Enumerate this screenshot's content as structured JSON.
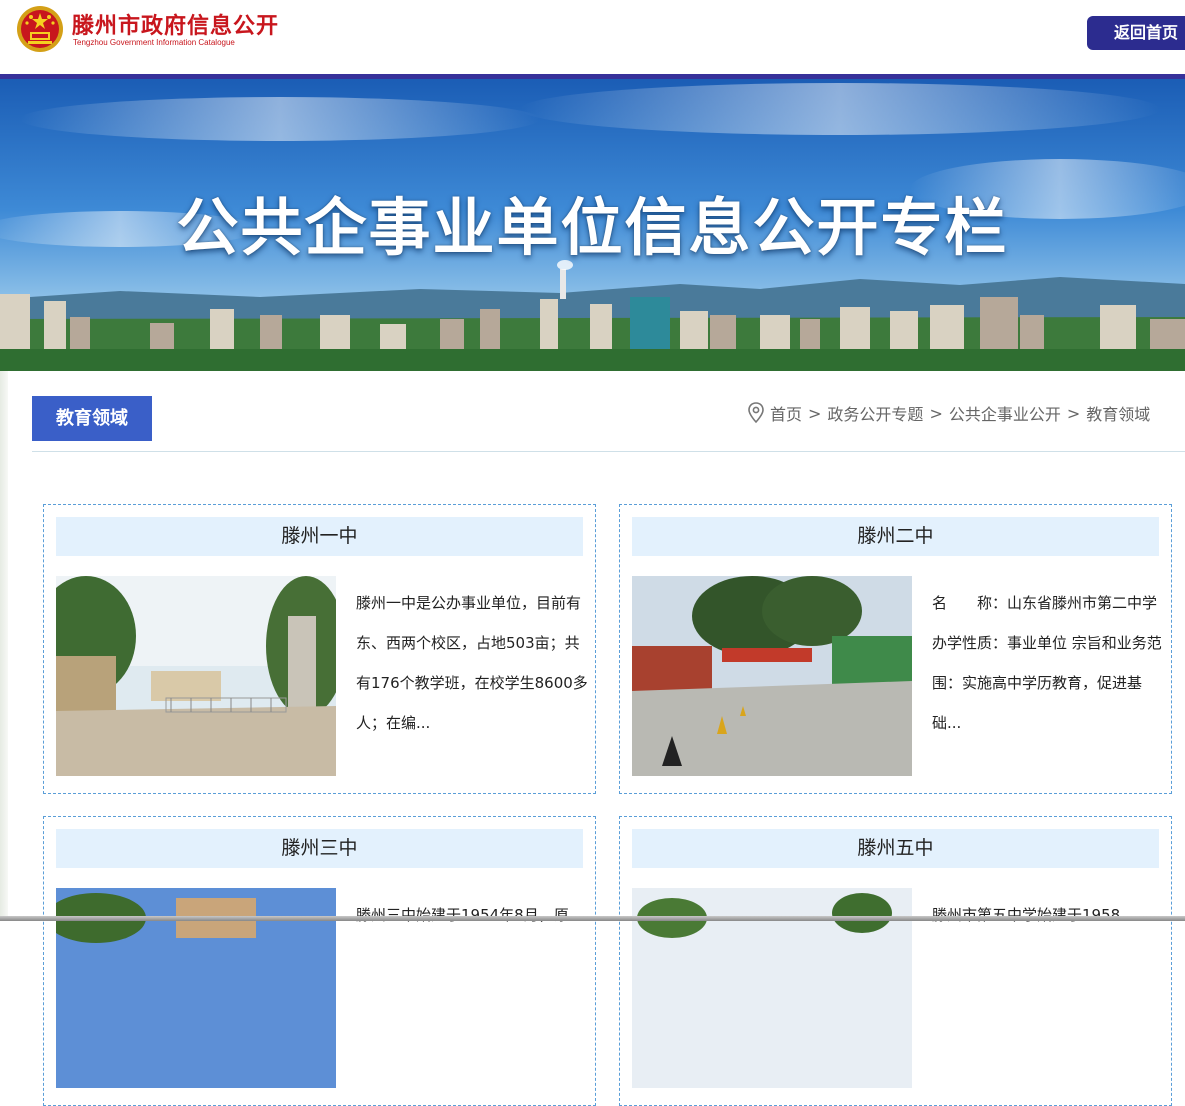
{
  "header": {
    "site_title": "滕州市政府信息公开",
    "site_subtitle": "Tengzhou Government Information Catalogue",
    "home_button": "返回首页",
    "accent_color": "#37319a",
    "title_color": "#c8161d"
  },
  "banner": {
    "title": "公共企事业单位信息公开专栏"
  },
  "section": {
    "tab_label": "教育领域",
    "tab_color": "#3a5fc8"
  },
  "breadcrumb": {
    "icon": "location-pin-icon",
    "items": [
      "首页",
      "政务公开专题",
      "公共企事业公开",
      "教育领域"
    ],
    "separator": ">"
  },
  "cards": [
    {
      "title": "滕州一中",
      "text": "滕州一中是公办事业单位，目前有东、西两个校区，占地503亩；共有176个教学班，在校学生8600多人；在编..."
    },
    {
      "title": "滕州二中",
      "text": "名　　称：山东省滕州市第二中学 办学性质：事业单位 宗旨和业务范围：实施高中学历教育，促进基础..."
    },
    {
      "title": "滕州三中",
      "text": "滕州三中始建于1954年8月，原"
    },
    {
      "title": "滕州五中",
      "text": "滕州市第五中学始建于1958"
    }
  ]
}
